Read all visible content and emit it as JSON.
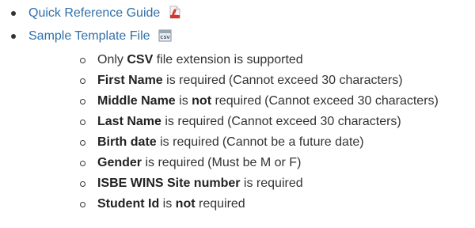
{
  "links": [
    {
      "label": "Quick Reference Guide",
      "icon": "pdf-icon"
    },
    {
      "label": "Sample Template File",
      "icon": "csv-file-icon",
      "icon_text": "CSV"
    }
  ],
  "requirements": [
    {
      "pre": "Only ",
      "bold": "CSV",
      "post": " file extension is supported",
      "note": ""
    },
    {
      "pre": "",
      "bold": "First Name",
      "post": " is required",
      "note": "(Cannot exceed 30 characters)"
    },
    {
      "pre": "",
      "bold": "Middle Name",
      "mid": " is ",
      "bold2": "not",
      "post": " required",
      "note": "(Cannot exceed 30 characters)"
    },
    {
      "pre": "",
      "bold": "Last Name",
      "post": " is required",
      "note": "(Cannot exceed 30 characters)"
    },
    {
      "pre": "",
      "bold": "Birth date",
      "post": " is required",
      "note": "(Cannot be a future date)"
    },
    {
      "pre": "",
      "bold": "Gender",
      "post": " is required",
      "note": "(Must be M or F)"
    },
    {
      "pre": "",
      "bold": "ISBE WINS Site number",
      "post": " is required",
      "note": ""
    },
    {
      "pre": "",
      "bold": "Student Id",
      "mid": " is ",
      "bold2": "not",
      "post": " required",
      "note": ""
    }
  ],
  "colors": {
    "link": "#2f6fa8",
    "text": "#333333",
    "pdf_red": "#d9342b"
  }
}
